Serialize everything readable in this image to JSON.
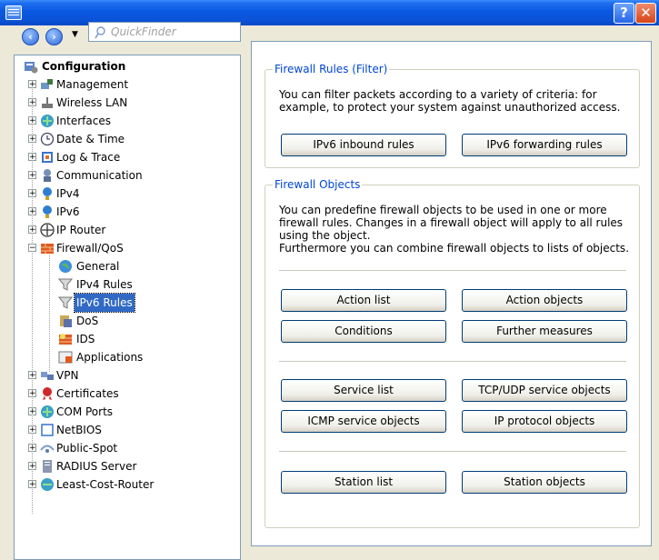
{
  "quickfinder_placeholder": "QuickFinder",
  "tree": {
    "root": "Configuration",
    "items": {
      "management": "Management",
      "wireless_lan": "Wireless LAN",
      "interfaces": "Interfaces",
      "date_time": "Date & Time",
      "log_trace": "Log & Trace",
      "communication": "Communication",
      "ipv4": "IPv4",
      "ipv6": "IPv6",
      "ip_router": "IP Router",
      "firewall_qos": "Firewall/QoS",
      "general": "General",
      "ipv4_rules": "IPv4 Rules",
      "ipv6_rules": "IPv6 Rules",
      "dos": "DoS",
      "ids": "IDS",
      "applications": "Applications",
      "vpn": "VPN",
      "certificates": "Certificates",
      "com_ports": "COM Ports",
      "netbios": "NetBIOS",
      "public_spot": "Public-Spot",
      "radius_server": "RADIUS Server",
      "least_cost_router": "Least-Cost-Router"
    }
  },
  "filter_group": {
    "title": "Firewall Rules (Filter)",
    "line1": "You can filter packets according to a variety of criteria: for",
    "line2": "example, to protect your system against unauthorized access.",
    "inbound_btn": "IPv6 inbound rules",
    "forwarding_btn": "IPv6 forwarding rules"
  },
  "objects_group": {
    "title": "Firewall Objects",
    "line1": "You can predefine firewall objects to be used in one or more",
    "line2": "firewall rules. Changes in a firewall object will apply to all rules",
    "line3": "using the object.",
    "line4": "Furthermore you can combine firewall objects to lists of objects.",
    "action_list": "Action list",
    "action_objects": "Action objects",
    "conditions": "Conditions",
    "further_measures": "Further measures",
    "service_list": "Service list",
    "tcp_udp_objects": "TCP/UDP service objects",
    "icmp_objects": "ICMP service objects",
    "ip_protocol_objects": "IP protocol objects",
    "station_list": "Station list",
    "station_objects": "Station objects"
  }
}
